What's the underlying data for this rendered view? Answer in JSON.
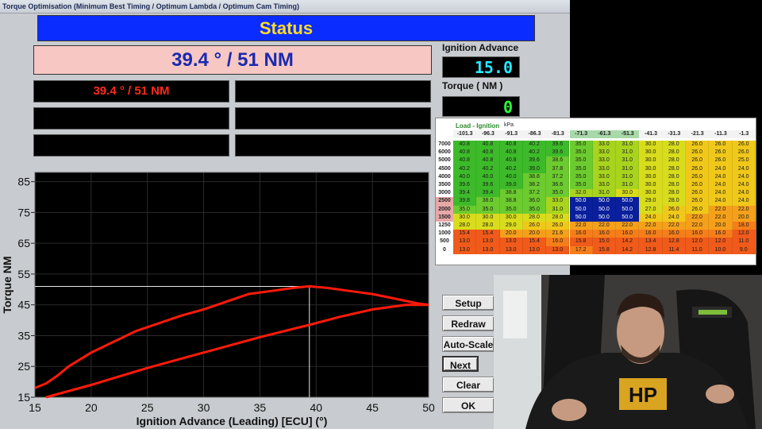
{
  "window": {
    "title": "Torque Optimisation (Minimum Best Timing / Optimum Lambda / Optimum Cam Timing)"
  },
  "status": {
    "label": "Status",
    "big_value": "39.4 ° / 51 NM"
  },
  "result_boxes": [
    "39.4 ° / 51 NM",
    "",
    "",
    "",
    "",
    ""
  ],
  "readouts": {
    "ignition_label": "Ignition Advance",
    "ignition_value": "15.0",
    "torque_label": "Torque ( NM )",
    "torque_value": "0"
  },
  "buttons": {
    "setup": "Setup",
    "redraw": "Redraw",
    "autoscale": "Auto-Scale",
    "next": "Next",
    "clear": "Clear",
    "ok": "OK"
  },
  "colors": {
    "status_bg": "#0a2cff",
    "status_text": "#ffdd22",
    "curve": "#ff1a0a",
    "digits": "#27e8ff"
  },
  "chart_data": {
    "type": "line",
    "xlabel": "Ignition Advance (Leading) [ECU] (°)",
    "ylabel": "Torque NM",
    "xlim": [
      15,
      50
    ],
    "ylim": [
      15,
      88
    ],
    "x_ticks": [
      15,
      20,
      25,
      30,
      35,
      40,
      45,
      50
    ],
    "y_ticks": [
      15,
      25,
      35,
      45,
      55,
      65,
      75,
      85
    ],
    "grid": true,
    "marker": {
      "x": 39.4,
      "y": 51
    },
    "series": [
      {
        "x": [
          15,
          16,
          17,
          18,
          20,
          22,
          24,
          26,
          28,
          30,
          32,
          34,
          36,
          38,
          39.4,
          41,
          43,
          45,
          47,
          49,
          50
        ],
        "y": [
          18,
          19.5,
          22,
          25,
          29.5,
          33,
          36.5,
          39,
          41.5,
          43.5,
          46,
          48.5,
          49.5,
          50.5,
          51,
          50.5,
          49.5,
          48.5,
          47,
          45.5,
          45
        ]
      },
      {
        "x": [
          16,
          20,
          25,
          30,
          35,
          39.4,
          42,
          45,
          48,
          50
        ],
        "y": [
          15,
          19,
          24.5,
          29.5,
          34.5,
          38.5,
          41,
          43.5,
          45,
          45
        ]
      }
    ]
  },
  "ignition_table": {
    "title": "Load - Ignition",
    "unit": "kPa",
    "columns": [
      "-101.3",
      "-96.3",
      "-91.3",
      "-86.3",
      "-81.3",
      "-71.3",
      "-61.3",
      "-51.3",
      "-41.3",
      "-31.3",
      "-21.3",
      "-11.3",
      "-1.3"
    ],
    "rows": [
      {
        "rpm": "7000",
        "values": [
          "40.8",
          "40.8",
          "40.8",
          "40.2",
          "39.6",
          "35.0",
          "33.0",
          "31.0",
          "30.0",
          "28.0",
          "26.0",
          "26.0",
          "26.0"
        ]
      },
      {
        "rpm": "6000",
        "values": [
          "40.8",
          "40.8",
          "40.8",
          "40.2",
          "39.6",
          "35.0",
          "33.0",
          "31.0",
          "30.0",
          "28.0",
          "26.0",
          "26.0",
          "26.0"
        ]
      },
      {
        "rpm": "5000",
        "values": [
          "40.8",
          "40.8",
          "40.8",
          "39.6",
          "38.6",
          "35.0",
          "33.0",
          "31.0",
          "30.0",
          "28.0",
          "26.0",
          "26.0",
          "25.0"
        ]
      },
      {
        "rpm": "4500",
        "values": [
          "40.2",
          "40.2",
          "40.2",
          "39.0",
          "37.8",
          "35.0",
          "33.0",
          "31.0",
          "30.0",
          "28.0",
          "26.0",
          "24.0",
          "24.0"
        ]
      },
      {
        "rpm": "4000",
        "values": [
          "40.0",
          "40.0",
          "40.0",
          "38.8",
          "37.2",
          "35.0",
          "33.0",
          "31.0",
          "30.0",
          "28.0",
          "26.0",
          "24.0",
          "24.0"
        ]
      },
      {
        "rpm": "3500",
        "values": [
          "39.6",
          "39.6",
          "39.0",
          "38.2",
          "36.6",
          "35.0",
          "33.0",
          "31.0",
          "30.0",
          "28.0",
          "26.0",
          "24.0",
          "24.0"
        ]
      },
      {
        "rpm": "3000",
        "values": [
          "39.4",
          "39.4",
          "38.8",
          "37.2",
          "35.0",
          "32.0",
          "31.0",
          "30.0",
          "30.0",
          "28.0",
          "26.0",
          "24.0",
          "24.0"
        ]
      },
      {
        "rpm": "2500",
        "values": [
          "39.8",
          "38.0",
          "38.8",
          "36.0",
          "33.0",
          "50.0",
          "50.0",
          "50.0",
          "29.0",
          "28.0",
          "26.0",
          "24.0",
          "24.0"
        ]
      },
      {
        "rpm": "2000",
        "values": [
          "35.0",
          "35.0",
          "35.0",
          "35.0",
          "31.0",
          "50.0",
          "50.0",
          "50.0",
          "27.0",
          "26.0",
          "26.0",
          "22.0",
          "22.0"
        ]
      },
      {
        "rpm": "1500",
        "values": [
          "30.0",
          "30.0",
          "30.0",
          "28.0",
          "28.0",
          "50.0",
          "50.0",
          "50.0",
          "24.0",
          "24.0",
          "22.0",
          "22.0",
          "20.0"
        ]
      },
      {
        "rpm": "1250",
        "values": [
          "28.0",
          "28.0",
          "29.0",
          "26.0",
          "26.0",
          "22.0",
          "22.0",
          "22.0",
          "22.0",
          "22.0",
          "22.0",
          "20.0",
          "18.0"
        ]
      },
      {
        "rpm": "1000",
        "values": [
          "15.4",
          "15.4",
          "20.0",
          "20.0",
          "21.6",
          "16.0",
          "16.0",
          "16.0",
          "16.0",
          "16.0",
          "16.0",
          "16.0",
          "12.0"
        ]
      },
      {
        "rpm": "500",
        "values": [
          "13.0",
          "13.0",
          "13.0",
          "15.4",
          "16.0",
          "15.8",
          "15.0",
          "14.2",
          "13.4",
          "12.8",
          "12.0",
          "12.0",
          "11.0"
        ]
      },
      {
        "rpm": "0",
        "values": [
          "13.0",
          "13.0",
          "13.0",
          "13.0",
          "13.0",
          "17.2",
          "15.8",
          "14.2",
          "12.8",
          "11.4",
          "11.0",
          "10.0",
          "9.0"
        ]
      }
    ]
  },
  "webcam": {
    "shirt_text": "HP"
  }
}
